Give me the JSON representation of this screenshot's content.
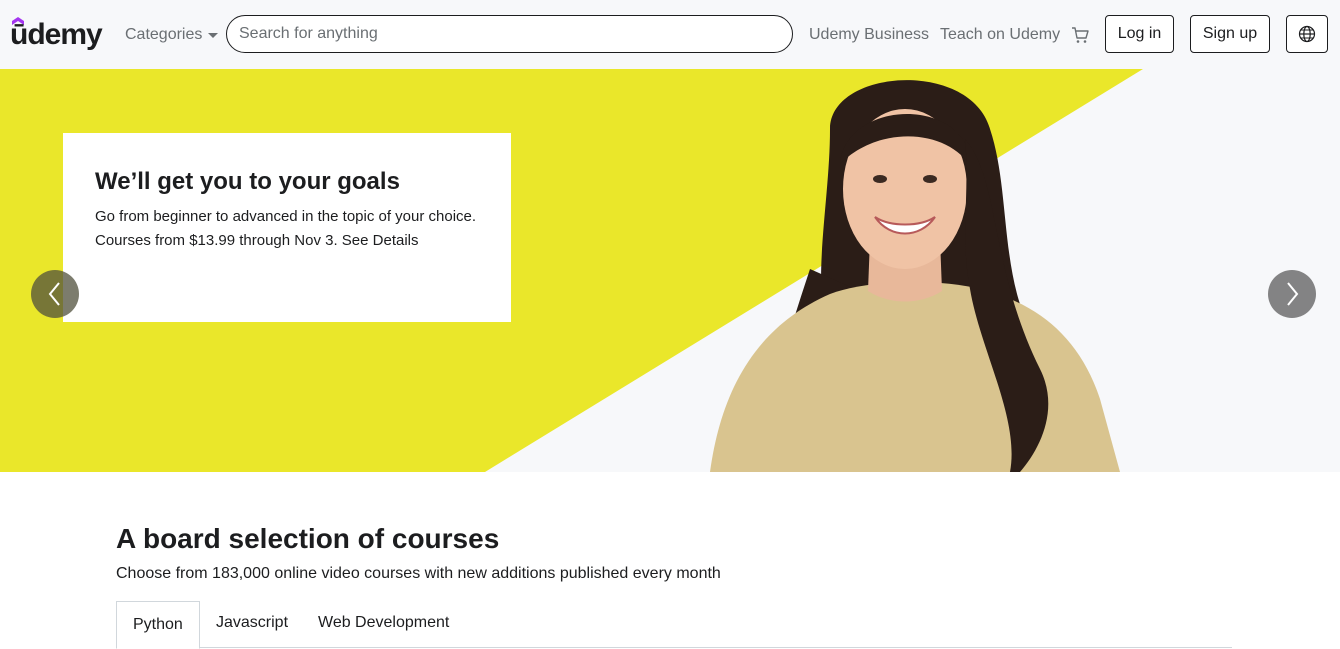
{
  "header": {
    "logo_text": "ūdemy",
    "categories_label": "Categories",
    "search_placeholder": "Search for anything",
    "business_link": "Udemy Business",
    "teach_link": "Teach on Udemy",
    "login_label": "Log in",
    "signup_label": "Sign up",
    "icons": [
      "cart-icon",
      "globe-icon",
      "caret-down-icon"
    ]
  },
  "hero": {
    "title": "We’ll get you to your goals",
    "description": "Go from beginner to advanced in the topic of your choice. Courses from $13.99 through Nov 3. See Details",
    "accent_color": "#eae72a"
  },
  "courses": {
    "title": "A board selection of courses",
    "subtitle": "Choose from 183,000 online video courses with new additions published every month",
    "tabs": [
      {
        "label": "Python",
        "active": true
      },
      {
        "label": "Javascript",
        "active": false
      },
      {
        "label": "Web Development",
        "active": false
      }
    ]
  },
  "colors": {
    "brand_purple": "#a435f0",
    "text": "#1c1d1f",
    "muted": "#6a6f73",
    "header_bg": "#f7f8fa"
  }
}
